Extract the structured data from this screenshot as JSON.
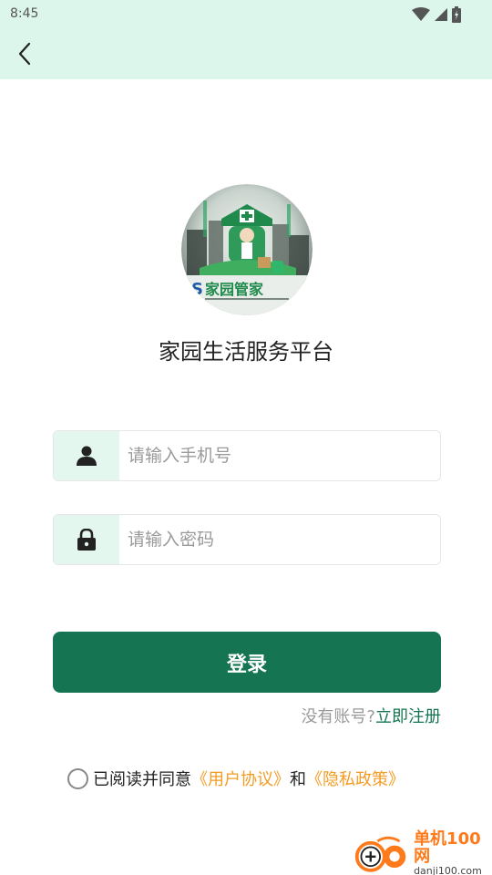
{
  "status_bar": {
    "time": "8:45"
  },
  "header": {
    "back_icon": "chevron-left-icon"
  },
  "app": {
    "title": "家园生活服务平台",
    "logo_text": "家园管家"
  },
  "form": {
    "phone_placeholder": "请输入手机号",
    "password_placeholder": "请输入密码",
    "phone_icon": "person-icon",
    "password_icon": "lock-icon"
  },
  "login_button": "登录",
  "register": {
    "prompt": "没有账号?",
    "link": "立即注册"
  },
  "agreement": {
    "prefix": "已阅读并同意",
    "user_agreement": "《用户协议》",
    "conjunction": "和",
    "privacy_policy": "《隐私政策》"
  },
  "watermark": {
    "title": "单机100网",
    "url": "danji100.com"
  },
  "colors": {
    "accent": "#157552",
    "header_bg": "#dcf6ec",
    "link_orange": "#f59b23",
    "icon_bg": "#e3f7ef"
  }
}
